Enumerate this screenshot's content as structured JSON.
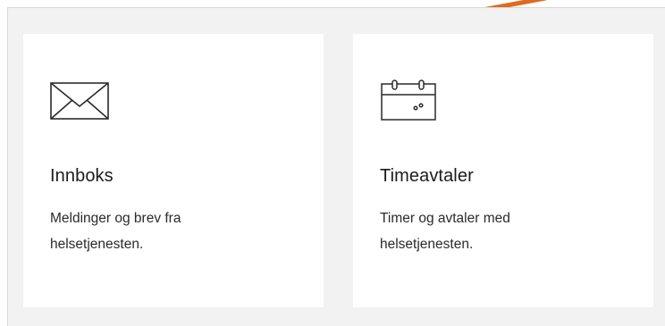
{
  "accent_color": "#e06a1e",
  "cards": [
    {
      "icon": "envelope-icon",
      "title": "Innboks",
      "description": "Meldinger og brev fra helsetjenesten."
    },
    {
      "icon": "calendar-icon",
      "title": "Timeavtaler",
      "description": "Timer og avtaler med helsetjenesten."
    }
  ]
}
